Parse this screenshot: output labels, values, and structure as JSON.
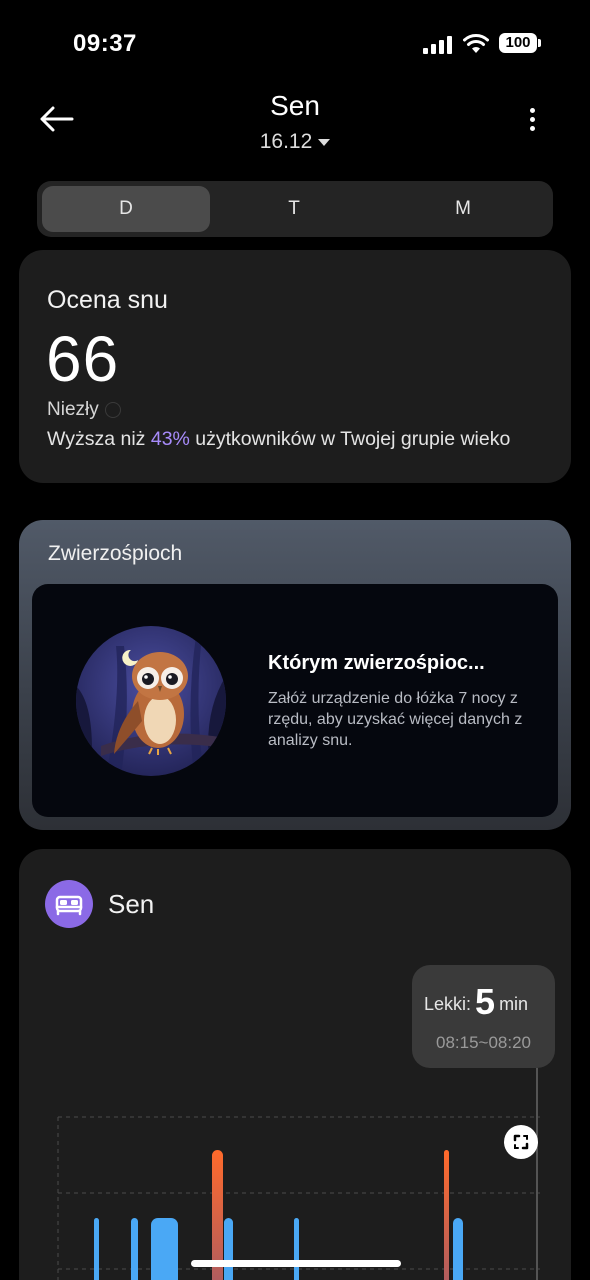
{
  "status_bar": {
    "time": "09:37",
    "battery": "100"
  },
  "header": {
    "title": "Sen",
    "date": "16.12"
  },
  "tabs": [
    {
      "label": "D",
      "active": true
    },
    {
      "label": "T",
      "active": false
    },
    {
      "label": "M",
      "active": false
    }
  ],
  "score_card": {
    "label": "Ocena snu",
    "value": "66",
    "rating": "Niezły",
    "compare_prefix": "Wyższa niż ",
    "compare_percent": "43%",
    "compare_suffix": " użytkowników w Twojej grupie wieko"
  },
  "animal_card": {
    "label": "Zwierzośpioch",
    "title": "Którym zwierzośpioc...",
    "description": "Załóż urządzenie do łóżka 7 nocy z rzędu, aby uzyskać więcej danych z analizy snu."
  },
  "sleep_card": {
    "title": "Sen",
    "tooltip": {
      "stage": "Lekki:",
      "value": "5",
      "unit": "min",
      "range": "08:15~08:20"
    }
  },
  "colors": {
    "accent_purple": "#8b6ae6",
    "percent": "#a78bfa",
    "light_sleep": "#4aa8f5",
    "awake": "#ff6a2b"
  },
  "icons": [
    "back-arrow-icon",
    "caret-down-icon",
    "more-vertical-icon",
    "bed-icon",
    "expand-icon",
    "info-icon",
    "owl-illustration"
  ]
}
